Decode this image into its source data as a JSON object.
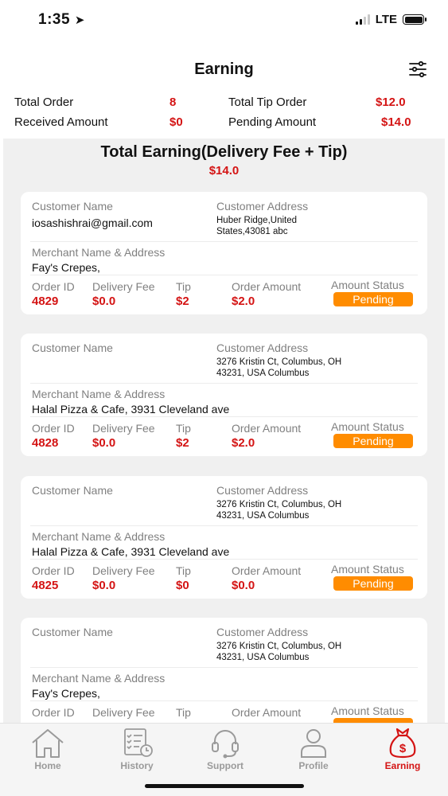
{
  "status_bar": {
    "time": "1:35",
    "network": "LTE"
  },
  "header": {
    "title": "Earning",
    "filter_icon": "filter-sliders-icon"
  },
  "summary": {
    "total_order_label": "Total Order",
    "total_order_value": "8",
    "total_tip_order_label": "Total Tip Order",
    "total_tip_order_value": "$12.0",
    "received_amount_label": "Received Amount",
    "received_amount_value": "$0",
    "pending_amount_label": "Pending Amount",
    "pending_amount_value": "$14.0"
  },
  "total_earning": {
    "title": "Total Earning(Delivery Fee + Tip)",
    "value": "$14.0"
  },
  "labels": {
    "customer_name": "Customer Name",
    "customer_address": "Customer Address",
    "merchant": "Merchant Name & Address",
    "order_id": "Order ID",
    "delivery_fee": "Delivery Fee",
    "tip": "Tip",
    "order_amount": "Order Amount",
    "amount_status": "Amount Status"
  },
  "orders": [
    {
      "customer_name": "iosashishrai@gmail.com",
      "address_line1": "Huber Ridge,United",
      "address_line2": "States,43081 abc",
      "merchant": "Fay's Crepes,",
      "order_id": "4829",
      "delivery_fee": "$0.0",
      "tip": "$2",
      "order_amount": "$2.0",
      "status": "Pending"
    },
    {
      "customer_name": "",
      "address_line1": "3276 Kristin Ct, Columbus, OH",
      "address_line2": "43231, USA Columbus",
      "merchant": "Halal Pizza & Cafe, 3931 Cleveland ave",
      "order_id": "4828",
      "delivery_fee": "$0.0",
      "tip": "$2",
      "order_amount": "$2.0",
      "status": "Pending"
    },
    {
      "customer_name": "",
      "address_line1": "3276 Kristin Ct, Columbus, OH",
      "address_line2": "43231, USA Columbus",
      "merchant": "Halal Pizza & Cafe, 3931 Cleveland ave",
      "order_id": "4825",
      "delivery_fee": "$0.0",
      "tip": "$0",
      "order_amount": "$0.0",
      "status": "Pending"
    },
    {
      "customer_name": "",
      "address_line1": "3276 Kristin Ct, Columbus, OH",
      "address_line2": "43231, USA Columbus",
      "merchant": "Fay's Crepes,",
      "order_id": "",
      "delivery_fee": "",
      "tip": "",
      "order_amount": "",
      "status": ""
    }
  ],
  "bottom_nav": [
    {
      "label": "Home",
      "icon": "home-icon"
    },
    {
      "label": "History",
      "icon": "history-icon"
    },
    {
      "label": "Support",
      "icon": "headset-icon"
    },
    {
      "label": "Profile",
      "icon": "profile-icon"
    },
    {
      "label": "Earning",
      "icon": "money-bag-icon",
      "active": true
    }
  ],
  "colors": {
    "accent_red": "#d41414",
    "pending_orange": "#ff8c00"
  }
}
